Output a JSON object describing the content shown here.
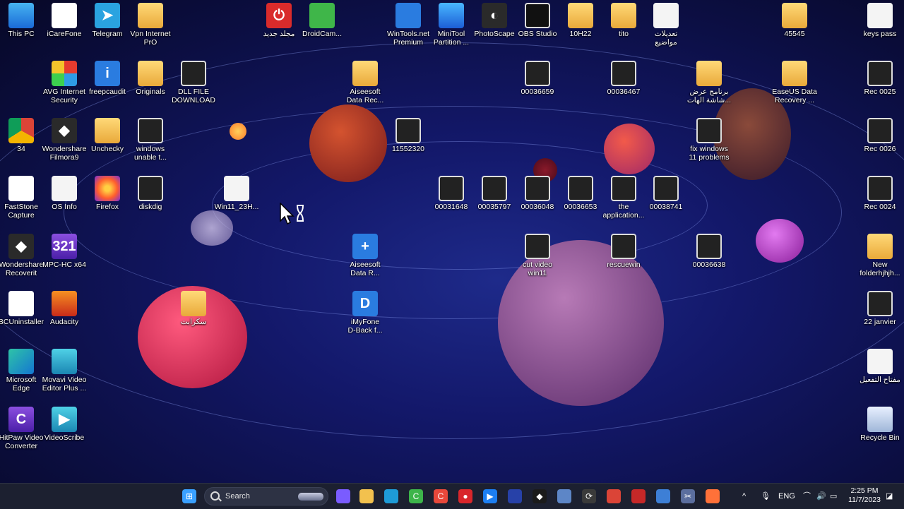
{
  "desktop": {
    "icons": [
      {
        "label": "This PC",
        "kind": "k-pc",
        "glyph": ""
      },
      {
        "label": "iCareFone",
        "kind": "k-white",
        "glyph": "C"
      },
      {
        "label": "Telegram",
        "kind": "k-tg",
        "glyph": "➤"
      },
      {
        "label": "Vpn Internet\nPrO",
        "kind": "k-folder",
        "glyph": ""
      },
      {
        "label": "مجلد جديد",
        "kind": "k-red",
        "glyph": "⏻"
      },
      {
        "label": "DroidCam...",
        "kind": "k-green",
        "glyph": ""
      },
      {
        "label": "WinTools.net\nPremium",
        "kind": "k-blue",
        "glyph": ""
      },
      {
        "label": "MiniTool\nPartition ...",
        "kind": "k-ice",
        "glyph": ""
      },
      {
        "label": "PhotoScape",
        "kind": "k-dark",
        "glyph": "◐"
      },
      {
        "label": "OBS Studio",
        "kind": "k-obs",
        "glyph": ""
      },
      {
        "label": "10H22",
        "kind": "k-folder",
        "glyph": ""
      },
      {
        "label": "tito",
        "kind": "k-folder",
        "glyph": ""
      },
      {
        "label": "تعديلات\nمواضيع",
        "kind": "k-doc",
        "glyph": ""
      },
      {
        "label": "45545",
        "kind": "k-folder",
        "glyph": ""
      },
      {
        "label": "keys pass",
        "kind": "k-doc",
        "glyph": ""
      },
      {
        "label": "AVG Internet\nSecurity",
        "kind": "k-avg",
        "glyph": ""
      },
      {
        "label": "freepcaudit",
        "kind": "k-blue",
        "glyph": "i"
      },
      {
        "label": "Originals",
        "kind": "k-folder",
        "glyph": ""
      },
      {
        "label": "DLL FILE\nDOWNLOAD",
        "kind": "k-vid",
        "glyph": ""
      },
      {
        "label": "Aiseesoft\nData Rec...",
        "kind": "k-folder",
        "glyph": ""
      },
      {
        "label": "00036659",
        "kind": "k-vid",
        "glyph": ""
      },
      {
        "label": "00036467",
        "kind": "k-vid",
        "glyph": ""
      },
      {
        "label": "برنامج عرض\nشاشة الهات...",
        "kind": "k-folder",
        "glyph": ""
      },
      {
        "label": "EaseUS Data\nRecovery ...",
        "kind": "k-folder",
        "glyph": ""
      },
      {
        "label": "Rec 0025",
        "kind": "k-vid",
        "glyph": ""
      },
      {
        "label": "34",
        "kind": "k-chrome",
        "glyph": ""
      },
      {
        "label": "Wondershare\nFilmora9",
        "kind": "k-dark",
        "glyph": "◆"
      },
      {
        "label": "Unchecky",
        "kind": "k-folder",
        "glyph": ""
      },
      {
        "label": "windows\nunable t...",
        "kind": "k-vid",
        "glyph": ""
      },
      {
        "label": "11552320",
        "kind": "k-vid",
        "glyph": ""
      },
      {
        "label": "fix windows\n11 problems",
        "kind": "k-vid",
        "glyph": ""
      },
      {
        "label": "Rec 0026",
        "kind": "k-vid",
        "glyph": ""
      },
      {
        "label": "FastStone\nCapture",
        "kind": "k-white",
        "glyph": "▲"
      },
      {
        "label": "OS Info",
        "kind": "k-doc",
        "glyph": ""
      },
      {
        "label": "Firefox",
        "kind": "k-ff",
        "glyph": ""
      },
      {
        "label": "diskdig",
        "kind": "k-vid",
        "glyph": ""
      },
      {
        "label": "Win11_23H...",
        "kind": "k-doc",
        "glyph": ""
      },
      {
        "label": "00031648",
        "kind": "k-vid",
        "glyph": ""
      },
      {
        "label": "00035797",
        "kind": "k-vid",
        "glyph": ""
      },
      {
        "label": "00036048",
        "kind": "k-vid",
        "glyph": ""
      },
      {
        "label": "00036653",
        "kind": "k-vid",
        "glyph": ""
      },
      {
        "label": "the\napplication...",
        "kind": "k-vid",
        "glyph": ""
      },
      {
        "label": "00038741",
        "kind": "k-vid",
        "glyph": ""
      },
      {
        "label": "Rec 0024",
        "kind": "k-vid",
        "glyph": ""
      },
      {
        "label": "Wondershare\nRecoverit",
        "kind": "k-dark",
        "glyph": "◆"
      },
      {
        "label": "MPC-HC x64",
        "kind": "k-purple",
        "glyph": "321"
      },
      {
        "label": "Aiseesoft\nData R...",
        "kind": "k-blue",
        "glyph": "+"
      },
      {
        "label": "cut video\nwin11",
        "kind": "k-vid",
        "glyph": ""
      },
      {
        "label": "rescuewin",
        "kind": "k-vid",
        "glyph": ""
      },
      {
        "label": "00036638",
        "kind": "k-vid",
        "glyph": ""
      },
      {
        "label": "New\nfolderhjhjh...",
        "kind": "k-folder",
        "glyph": ""
      },
      {
        "label": "BCUninstaller",
        "kind": "k-white",
        "glyph": "B"
      },
      {
        "label": "Audacity",
        "kind": "k-audacity",
        "glyph": ""
      },
      {
        "label": "سكرابت",
        "kind": "k-folder",
        "glyph": ""
      },
      {
        "label": "iMyFone\nD-Back f...",
        "kind": "k-blue",
        "glyph": "D"
      },
      {
        "label": "22 janvier",
        "kind": "k-vid",
        "glyph": ""
      },
      {
        "label": "Microsoft\nEdge",
        "kind": "k-edge",
        "glyph": ""
      },
      {
        "label": "Movavi Video\nEditor Plus ...",
        "kind": "k-teal",
        "glyph": ""
      },
      {
        "label": "مفتاح التفعيل",
        "kind": "k-doc",
        "glyph": ""
      },
      {
        "label": "HitPaw Video\nConverter",
        "kind": "k-purple",
        "glyph": "C"
      },
      {
        "label": "VideoScribe",
        "kind": "k-teal",
        "glyph": "▶"
      },
      {
        "label": "Recycle Bin",
        "kind": "k-bin",
        "glyph": ""
      }
    ]
  },
  "taskbar": {
    "search_placeholder": "Search",
    "language": "ENG",
    "time": "2:25 PM",
    "date": "11/7/2023",
    "apps": [
      {
        "name": "windows-start-icon",
        "color": "#3aa0ff",
        "glyph": "⊞"
      },
      {
        "name": "widgets-icon",
        "color": "#7a5cff",
        "glyph": ""
      },
      {
        "name": "file-explorer-icon",
        "color": "#f2c14e",
        "glyph": ""
      },
      {
        "name": "edge-icon",
        "color": "#1e9bd7",
        "glyph": ""
      },
      {
        "name": "camtasia-icon",
        "color": "#3db54a",
        "glyph": "C"
      },
      {
        "name": "capcut-icon",
        "color": "#e8483b",
        "glyph": "C"
      },
      {
        "name": "screen-recorder-icon",
        "color": "#d9262b",
        "glyph": "●"
      },
      {
        "name": "zoom-icon",
        "color": "#1c7ef2",
        "glyph": "▶"
      },
      {
        "name": "app-icon-blue",
        "color": "#2741a8",
        "glyph": ""
      },
      {
        "name": "filmora-icon",
        "color": "#1b1b1b",
        "glyph": "◆"
      },
      {
        "name": "photos-icon",
        "color": "#5d86c7",
        "glyph": ""
      },
      {
        "name": "settings-icon",
        "color": "#3a3a3a",
        "glyph": "⟳"
      },
      {
        "name": "chrome-icon",
        "color": "#db4437",
        "glyph": ""
      },
      {
        "name": "app-icon-red",
        "color": "#c62828",
        "glyph": ""
      },
      {
        "name": "monitor-icon",
        "color": "#3d7fd6",
        "glyph": ""
      },
      {
        "name": "snipping-tool-icon",
        "color": "#5b6e9e",
        "glyph": "✂"
      },
      {
        "name": "firefox-icon",
        "color": "#ff7139",
        "glyph": ""
      }
    ]
  }
}
